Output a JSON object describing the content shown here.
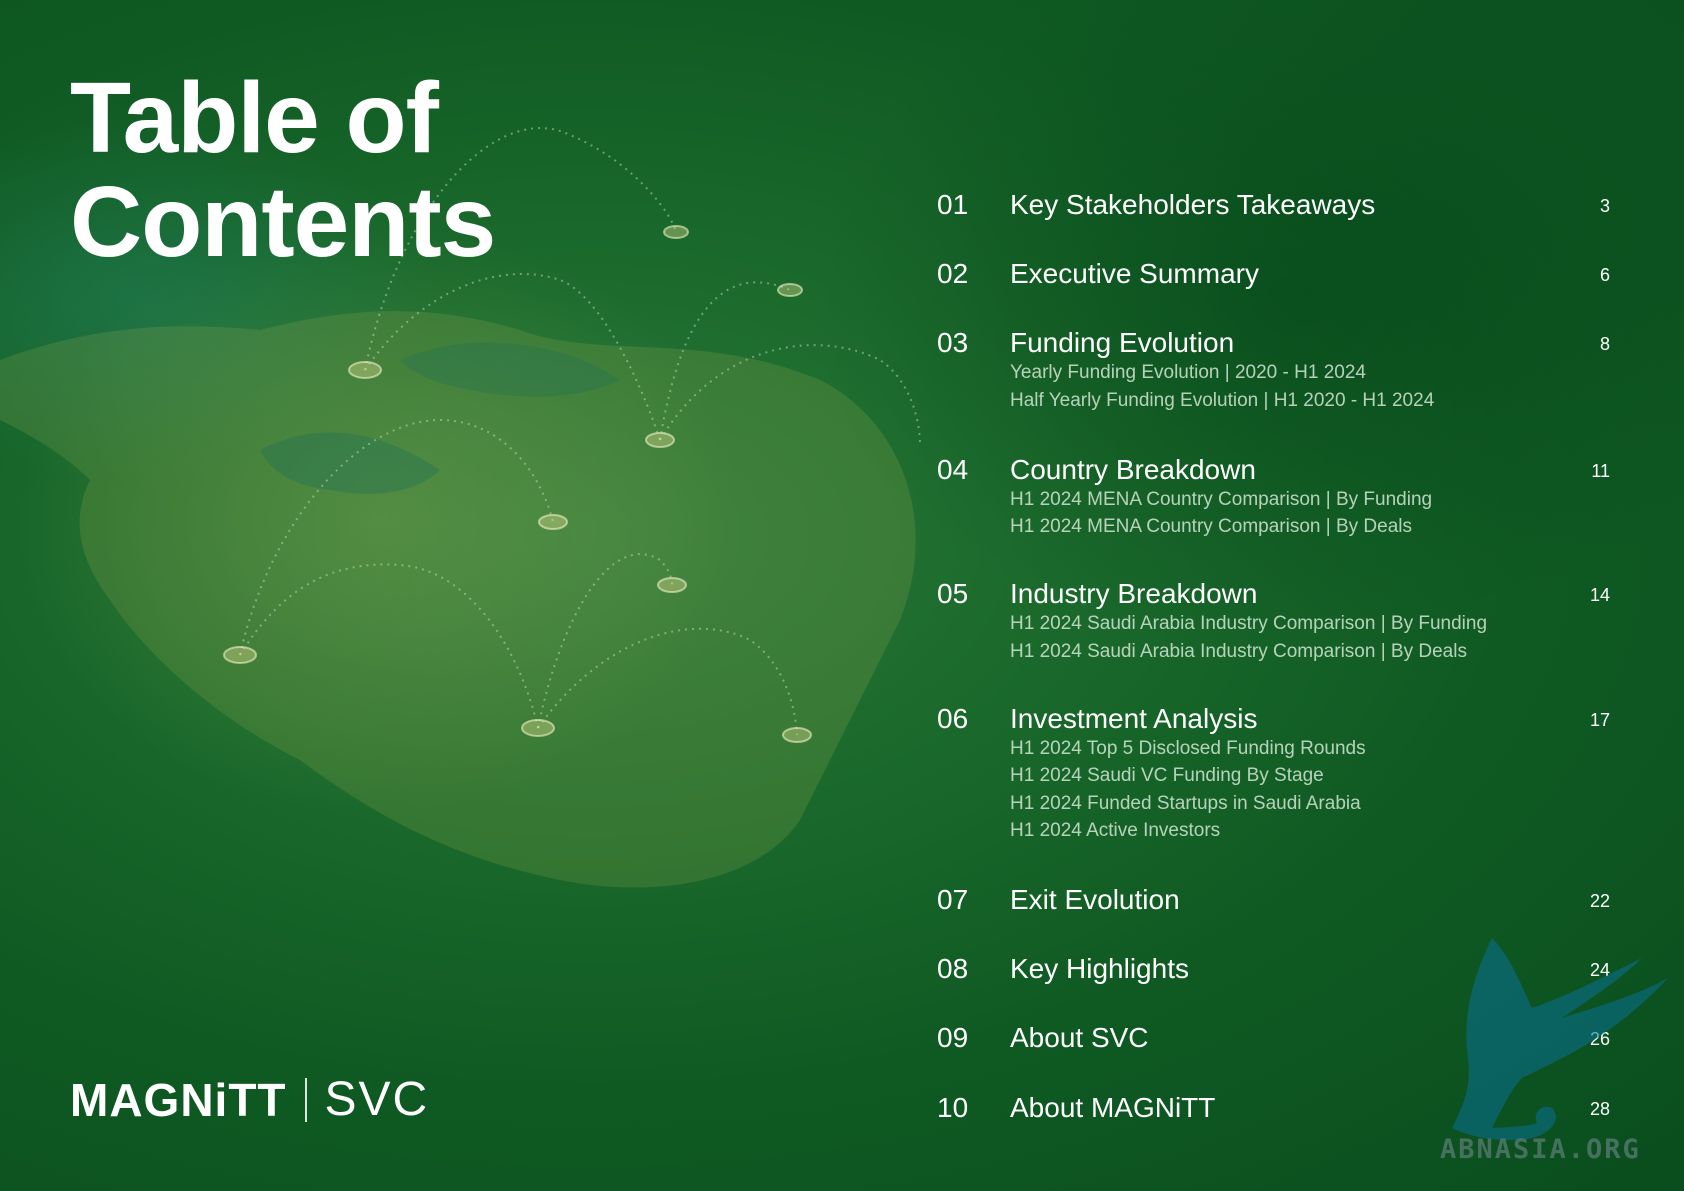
{
  "title": {
    "line1": "Table of",
    "line2": "Contents"
  },
  "logos": {
    "magnitt": "MAGNiTT",
    "svc": "SVC"
  },
  "toc": [
    {
      "num": "01",
      "heading": "Key Stakeholders Takeaways",
      "page": "3",
      "subs": []
    },
    {
      "num": "02",
      "heading": "Executive Summary",
      "page": "6",
      "subs": []
    },
    {
      "num": "03",
      "heading": "Funding Evolution",
      "page": "8",
      "subs": [
        "Yearly Funding Evolution | 2020 - H1 2024",
        "Half Yearly Funding Evolution | H1 2020 - H1 2024"
      ]
    },
    {
      "num": "04",
      "heading": "Country Breakdown",
      "page": "11",
      "subs": [
        "H1 2024 MENA Country Comparison | By Funding",
        "H1 2024 MENA Country Comparison | By Deals"
      ]
    },
    {
      "num": "05",
      "heading": "Industry Breakdown",
      "page": "14",
      "subs": [
        "H1 2024 Saudi Arabia Industry Comparison | By Funding",
        "H1 2024 Saudi Arabia Industry Comparison | By Deals"
      ]
    },
    {
      "num": "06",
      "heading": "Investment Analysis",
      "page": "17",
      "subs": [
        "H1 2024 Top 5 Disclosed Funding Rounds",
        "H1 2024 Saudi VC Funding By Stage",
        "H1 2024 Funded Startups in Saudi Arabia",
        "H1 2024 Active Investors"
      ]
    },
    {
      "num": "07",
      "heading": "Exit Evolution",
      "page": "22",
      "subs": []
    },
    {
      "num": "08",
      "heading": "Key Highlights",
      "page": "24",
      "subs": []
    },
    {
      "num": "09",
      "heading": "About SVC",
      "page": "26",
      "subs": []
    },
    {
      "num": "10",
      "heading": "About MAGNiTT",
      "page": "28",
      "subs": []
    }
  ],
  "watermark": {
    "text": "ABNASIA.ORG"
  }
}
